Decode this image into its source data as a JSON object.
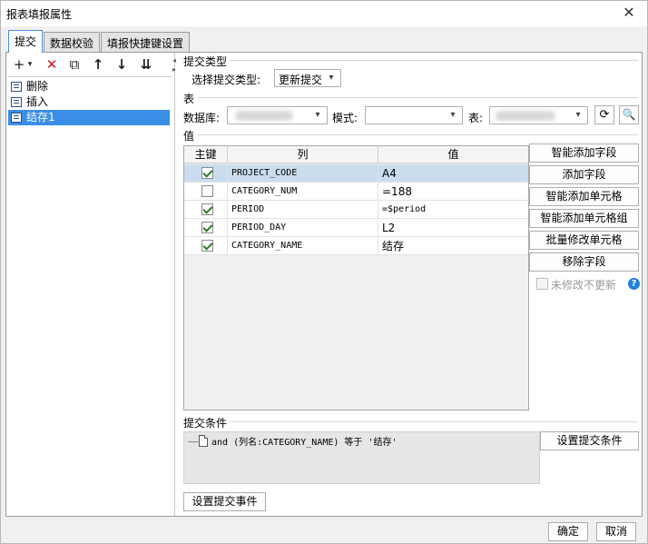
{
  "window": {
    "title": "报表填报属性",
    "close_icon": "close-icon"
  },
  "tabs": [
    {
      "label": "提交",
      "active": true
    },
    {
      "label": "数据校验",
      "active": false
    },
    {
      "label": "填报快捷键设置",
      "active": false
    }
  ],
  "toolbar": {
    "add": "+",
    "add_caret": "▾",
    "delete": "✕",
    "copy": "⧉",
    "move_up": "↑",
    "move_down": "↓",
    "sort": "⇊"
  },
  "actions": [
    {
      "label": "删除",
      "selected": false
    },
    {
      "label": "插入",
      "selected": false
    },
    {
      "label": "结存1",
      "selected": true
    }
  ],
  "submit_type": {
    "section": "提交类型",
    "label": "选择提交类型:",
    "value": "更新提交"
  },
  "table": {
    "section": "表",
    "database_label": "数据库:",
    "database_value": "",
    "mode_label": "模式:",
    "mode_value": "",
    "table_label": "表:",
    "table_value": "",
    "refresh_icon": "refresh-icon",
    "preview_icon": "preview-icon"
  },
  "values": {
    "section": "值",
    "columns": [
      "主键",
      "列",
      "值"
    ],
    "rows": [
      {
        "key": true,
        "column": "PROJECT_CODE",
        "value": "A4",
        "selected": true
      },
      {
        "key": false,
        "column": "CATEGORY_NUM",
        "value": "=188",
        "selected": false
      },
      {
        "key": true,
        "column": "PERIOD",
        "value": "=$period",
        "selected": false
      },
      {
        "key": true,
        "column": "PERIOD_DAY",
        "value": "L2",
        "selected": false
      },
      {
        "key": true,
        "column": "CATEGORY_NAME",
        "value": "结存",
        "selected": false
      }
    ]
  },
  "side_buttons": {
    "smart_add_field": "智能添加字段",
    "add_field": "添加字段",
    "smart_add_cell": "智能添加单元格",
    "smart_add_cell_group": "智能添加单元格组",
    "batch_edit_cells": "批量修改单元格",
    "remove_field": "移除字段",
    "no_update_unchanged": "未修改不更新",
    "help_icon": "?"
  },
  "submit_condition": {
    "section": "提交条件",
    "condition_text": "and (列名:CATEGORY_NAME) 等于 '结存'",
    "set_button": "设置提交条件"
  },
  "event_button": "设置提交事件",
  "footer": {
    "ok": "确定",
    "cancel": "取消"
  }
}
